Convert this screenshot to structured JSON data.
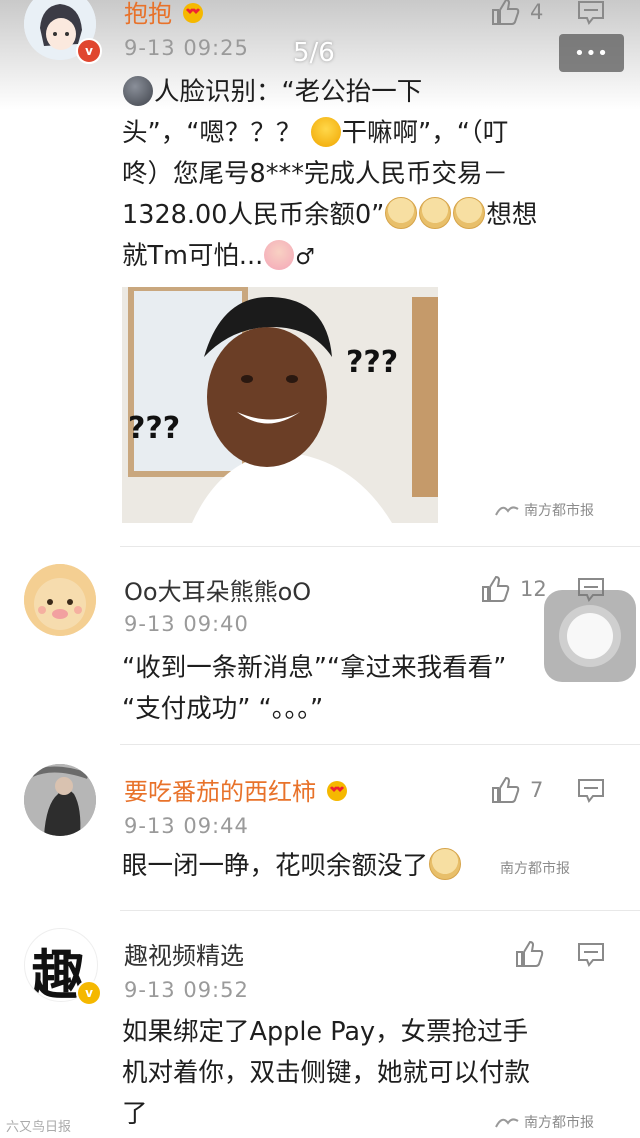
{
  "viewer": {
    "page_indicator": "5/6",
    "more_label": "•••"
  },
  "comments": [
    {
      "username": "抱抱",
      "time": "9-13 09:25",
      "likes": "4",
      "text_lines": [
        "人脸识别：“老公抬一下",
        "头”，“嗯？？？ ",
        "干嘛啊”，“（叮",
        "咚）您尾号8***完成人民币交易－",
        "1328.00人民币余额0”",
        "想想",
        "就Tm可怕...",
        "♂"
      ],
      "image_overlay": {
        "left_text": "???",
        "right_text": "???"
      }
    },
    {
      "username": "Oo大耳朵熊熊oO",
      "time": "9-13 09:40",
      "likes": "12",
      "text_lines": [
        "“收到一条新消息”“拿过来我看看”",
        "“支付成功”  “。。。”"
      ]
    },
    {
      "username": "要吃番茄的西红柿",
      "time": "9-13 09:44",
      "likes": "7",
      "text_lines": [
        "眼一闭一睁，花呗余额没了"
      ]
    },
    {
      "username": "趣视频精选",
      "time": "9-13 09:52",
      "likes": "",
      "avatar_text": "趣",
      "text_lines": [
        "如果绑定了Apple Pay，女票抢过手",
        "机对着你，双击侧键，她就可以付款",
        "了"
      ]
    }
  ],
  "watermark": "南方都市报",
  "corner_watermark": "六又鸟日报",
  "colors": {
    "orange_name": "#e8722a",
    "badge_red": "#e0462f",
    "badge_yellow": "#f5b800"
  }
}
